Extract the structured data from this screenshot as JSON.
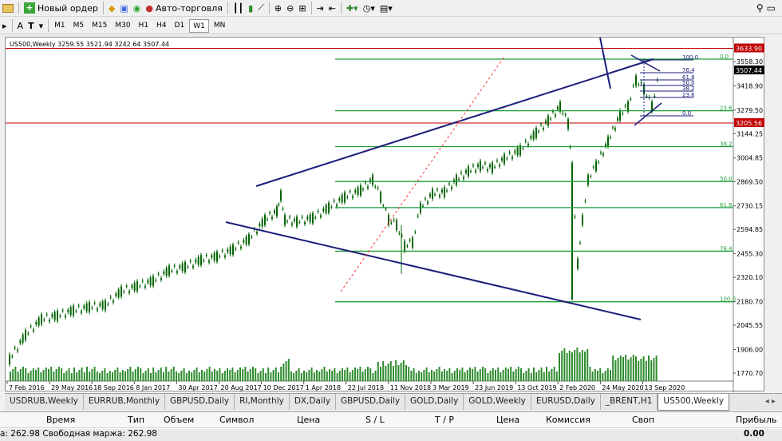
{
  "toolbar": {
    "new_order": "Новый ордер",
    "auto_trading": "Авто-торговля"
  },
  "toolbar2": {
    "letter_a": "A",
    "letter_t": "T",
    "timeframes": [
      "M1",
      "M5",
      "M15",
      "M30",
      "H1",
      "H4",
      "D1",
      "W1",
      "MN"
    ],
    "active_timeframe": "W1"
  },
  "chart": {
    "header": "US500,Weekly  3259.55 3521.94 3242.64 3507.44",
    "price_ticks": [
      "3558.30",
      "3418.90",
      "3279.50",
      "3144.25",
      "3004.85",
      "2869.50",
      "2730.15",
      "2594.85",
      "2455.30",
      "2320.10",
      "2180.70",
      "2045.55",
      "1906.00",
      "1770.70"
    ],
    "price_labels": {
      "top_red": "3633.90",
      "current": "3507.44",
      "bottom_red": "3205.56"
    },
    "date_ticks": [
      "7 Feb 2016",
      "29 May 2016",
      "18 Sep 2016",
      "8 Jan 2017",
      "30 Apr 2017",
      "20 Aug 2017",
      "10 Dec 2017",
      "1 Apr 2018",
      "22 Jul 2018",
      "11 Nov 2018",
      "3 Mar 2019",
      "23 Jun 2019",
      "13 Oct 2019",
      "2 Feb 2020",
      "24 May 2020",
      "13 Sep 2020"
    ],
    "fib_big": [
      "0.0",
      "23.6",
      "38.2",
      "50.0",
      "61.8",
      "76.4",
      "100.0"
    ],
    "fib_small": [
      "100.0",
      "76.4",
      "61.8",
      "50.0",
      "38.2",
      "23.6",
      "0.0"
    ]
  },
  "tabs": {
    "items": [
      "USDRUB,Weekly",
      "EURRUB,Monthly",
      "GBPUSD,Daily",
      "RI,Monthly",
      "DX,Daily",
      "GBPUSD,Daily",
      "GOLD,Daily",
      "GOLD,Weekly",
      "EURUSD,Daily",
      "_BRENT,H1",
      "US500,Weekly"
    ],
    "active": "US500,Weekly"
  },
  "terminal": {
    "columns": [
      "Время",
      "Тип",
      "Объем",
      "Символ",
      "Цена",
      "S / L",
      "T / P",
      "Цена",
      "Комиссия",
      "Своп",
      "Прибыль"
    ],
    "balance_text": "а: 262.98  Свободная маржа: 262.98",
    "profit_total": "0.00"
  },
  "colors": {
    "candle": "#006400",
    "channel": "#1c1c7a",
    "fib": "#1e9e3a",
    "red_line": "#c00000",
    "volume": "#2e8b2e",
    "dashed_trend": "#ff3030"
  }
}
